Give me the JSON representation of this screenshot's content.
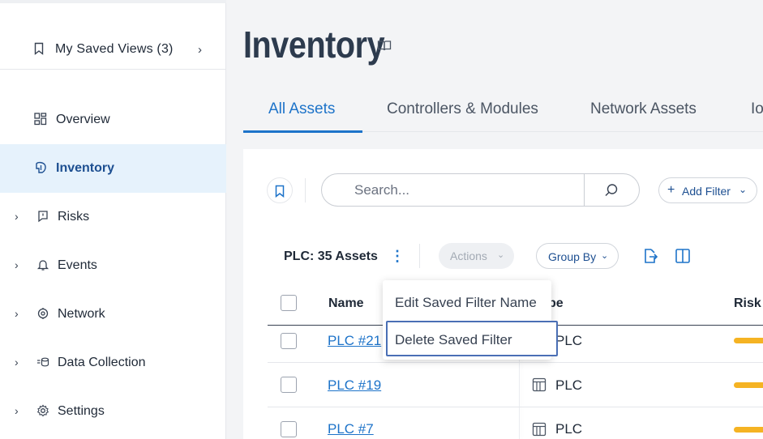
{
  "sidebar": {
    "saved_views_label": "My Saved Views (3)",
    "items": [
      {
        "label": "Overview",
        "icon": "dashboard-icon"
      },
      {
        "label": "Inventory",
        "icon": "inventory-icon"
      },
      {
        "label": "Risks",
        "icon": "risks-icon"
      },
      {
        "label": "Events",
        "icon": "bell-icon"
      },
      {
        "label": "Network",
        "icon": "network-icon"
      },
      {
        "label": "Data Collection",
        "icon": "data-collection-icon"
      },
      {
        "label": "Settings",
        "icon": "gear-icon"
      }
    ],
    "active_item": "Inventory"
  },
  "header": {
    "title": "Inventory"
  },
  "tabs": [
    {
      "label": "All Assets"
    },
    {
      "label": "Controllers & Modules"
    },
    {
      "label": "Network Assets"
    },
    {
      "label": "Io"
    }
  ],
  "toolbar": {
    "search_placeholder": "Search...",
    "add_filter_label": "Add Filter",
    "asset_count": "PLC: 35 Assets",
    "actions_label": "Actions",
    "group_by_label": "Group By"
  },
  "table": {
    "columns": [
      "Name",
      "pe",
      "Risk"
    ],
    "rows": [
      {
        "name": "PLC #21",
        "type": "PLC"
      },
      {
        "name": "PLC #19",
        "type": "PLC"
      },
      {
        "name": "PLC #7",
        "type": "PLC"
      }
    ]
  },
  "context_menu": {
    "items": [
      "Edit Saved Filter Name",
      "Delete Saved Filter"
    ],
    "focused": "Delete Saved Filter"
  },
  "colors": {
    "accent": "#1d73c9",
    "active_bg": "#e6f2fc",
    "risk": "#f5b323"
  }
}
